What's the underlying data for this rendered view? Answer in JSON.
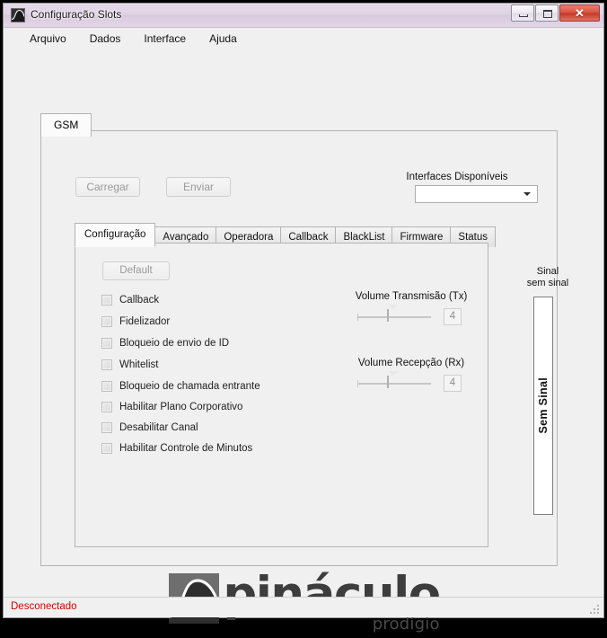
{
  "window": {
    "title": "Configuração Slots",
    "icon": "pinaculo-app-icon",
    "buttons": {
      "minimize": "minimize-icon",
      "maximize": "maximize-icon",
      "close": "✕"
    }
  },
  "menubar": {
    "items": [
      {
        "label": "Arquivo",
        "name": "menu-arquivo"
      },
      {
        "label": "Dados",
        "name": "menu-dados"
      },
      {
        "label": "Interface",
        "name": "menu-interface"
      },
      {
        "label": "Ajuda",
        "name": "menu-ajuda"
      }
    ]
  },
  "gsm_tab": {
    "label": "GSM",
    "actions": {
      "load_label": "Carregar",
      "send_label": "Enviar"
    },
    "interfaces": {
      "label": "Interfaces Disponíveis",
      "selected": "",
      "placeholder": "",
      "options": []
    }
  },
  "inner_tabs": [
    {
      "label": "Configuração",
      "active": true
    },
    {
      "label": "Avançado",
      "active": false
    },
    {
      "label": "Operadora",
      "active": false
    },
    {
      "label": "Callback",
      "active": false
    },
    {
      "label": "BlackList",
      "active": false
    },
    {
      "label": "Firmware",
      "active": false
    },
    {
      "label": "Status",
      "active": false
    }
  ],
  "configuracao": {
    "default_button": "Default",
    "checkboxes": [
      {
        "label": "Callback",
        "checked": false
      },
      {
        "label": "Fidelizador",
        "checked": false
      },
      {
        "label": "Bloqueio de envio de ID",
        "checked": false
      },
      {
        "label": "Whitelist",
        "checked": false
      },
      {
        "label": "Bloqueio de chamada entrante",
        "checked": false
      },
      {
        "label": "Habilitar Plano Corporativo",
        "checked": false
      },
      {
        "label": "Desabilitar Canal",
        "checked": false
      },
      {
        "label": "Habilitar Controle de Minutos",
        "checked": false
      }
    ],
    "sliders": [
      {
        "title": "Volume Transmisão (Tx)",
        "value": "4"
      },
      {
        "title": "Volume Recepção (Rx)",
        "value": "4"
      }
    ]
  },
  "signal": {
    "title": "Sinal",
    "subtitle": "sem sinal",
    "bar_text": "Sem Sinal"
  },
  "logo": {
    "word": "pináculo",
    "sub": "prodígio"
  },
  "statusbar": {
    "text": "Desconectado",
    "color": "#d40000"
  }
}
